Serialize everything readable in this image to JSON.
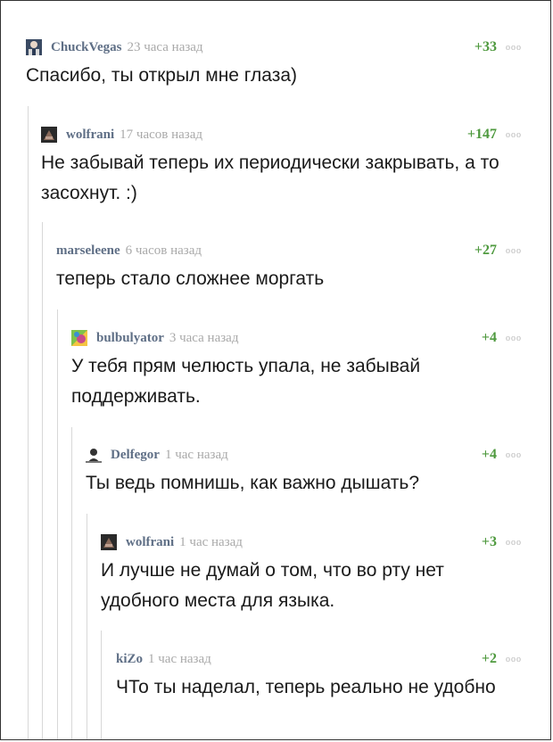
{
  "comments": [
    {
      "username": "ChuckVegas",
      "time": "23 часа назад",
      "rating": "+33",
      "more": "ooo",
      "text": "Спасибо, ты открыл мне глаза)",
      "avatar": "photo-avatar"
    },
    {
      "username": "wolfrani",
      "time": "17 часов назад",
      "rating": "+147",
      "more": "ooo",
      "text": "Не забывай теперь их периодически закрывать, а то засохнут. :)",
      "avatar": "dark-avatar"
    },
    {
      "username": "marseleene",
      "time": "6 часов назад",
      "rating": "+27",
      "more": "ooo",
      "text": "теперь стало сложнее моргать",
      "avatar": ""
    },
    {
      "username": "bulbulyator",
      "time": "3 часа назад",
      "rating": "+4",
      "more": "ooo",
      "text": "У тебя прям челюсть упала, не забывай поддерживать.",
      "avatar": "colorful-avatar"
    },
    {
      "username": "Delfegor",
      "time": "1 час назад",
      "rating": "+4",
      "more": "ooo",
      "text": "Ты ведь помнишь, как важно дышать?",
      "avatar": "person-avatar"
    },
    {
      "username": "wolfrani",
      "time": "1 час назад",
      "rating": "+3",
      "more": "ooo",
      "text": "И лучше не думай о том, что во рту нет удобного места для языка.",
      "avatar": "dark-avatar"
    },
    {
      "username": "kiZo",
      "time": "1 час назад",
      "rating": "+2",
      "more": "ooo",
      "text": "ЧТо ты наделал, теперь реально не удобно",
      "avatar": ""
    }
  ],
  "colors": {
    "username": "#5f6f86",
    "time": "#a9a9a9",
    "rating": "#4f9a3f",
    "thread_line": "#d8d8d8"
  }
}
